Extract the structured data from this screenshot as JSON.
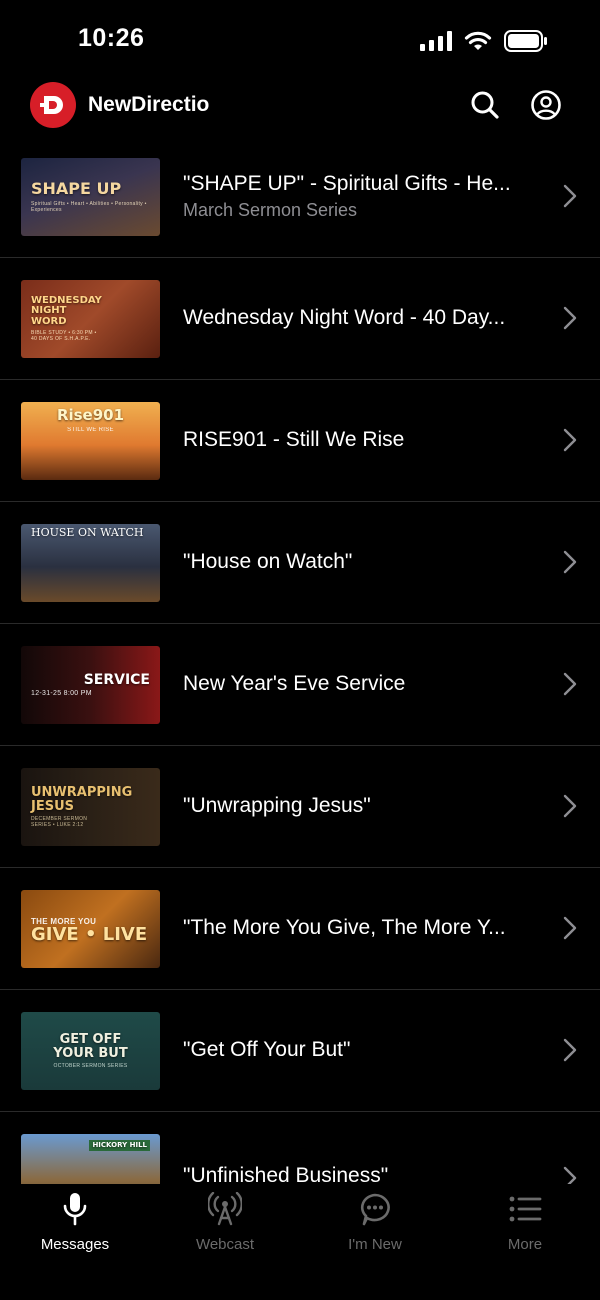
{
  "status": {
    "time": "10:26"
  },
  "header": {
    "title": "NewDirectio"
  },
  "items": [
    {
      "title": "\"SHAPE UP\" - Spiritual Gifts - He...",
      "subtitle": "March Sermon Series",
      "thumb": {
        "title": "SHAPE UP",
        "sub": "Spiritual Gifts • Heart • Abilities • Personality • Experiences"
      }
    },
    {
      "title": "Wednesday Night Word - 40 Day...",
      "subtitle": "",
      "thumb": {
        "title": "WEDNESDAY NIGHT WORD",
        "sub": "BIBLE STUDY • 6:30 PM  •  40 DAYS OF S.H.A.P.E."
      }
    },
    {
      "title": "RISE901 - Still We Rise",
      "subtitle": "",
      "thumb": {
        "title": "Rise901",
        "sub": "STILL WE RISE"
      }
    },
    {
      "title": "\"House on Watch\"",
      "subtitle": "",
      "thumb": {
        "title": "HOUSE ON WATCH",
        "sub": ""
      }
    },
    {
      "title": "New Year's Eve Service",
      "subtitle": "",
      "thumb": {
        "title": "SERVICE",
        "sub": "12-31-25  8:00 PM"
      }
    },
    {
      "title": "\"Unwrapping Jesus\"",
      "subtitle": "",
      "thumb": {
        "title": "UNWRAPPING JESUS",
        "sub": "DECEMBER SERMON SERIES • LUKE 2:12"
      }
    },
    {
      "title": "\"The More You Give, The More Y...",
      "subtitle": "",
      "thumb": {
        "title": "GIVE • LIVE",
        "sub": "THE MORE YOU"
      }
    },
    {
      "title": "\"Get Off Your But\"",
      "subtitle": "",
      "thumb": {
        "title": "GET OFF YOUR BUT",
        "sub": "OCTOBER SERMON SERIES"
      }
    },
    {
      "title": "\"Unfinished Business\"",
      "subtitle": "",
      "thumb": {
        "title": "HICKORY HILL",
        "sub": ""
      }
    }
  ],
  "tabs": [
    {
      "label": "Messages",
      "icon": "microphone-icon",
      "active": true
    },
    {
      "label": "Webcast",
      "icon": "broadcast-icon",
      "active": false
    },
    {
      "label": "I'm New",
      "icon": "chat-bubble-icon",
      "active": false
    },
    {
      "label": "More",
      "icon": "list-icon",
      "active": false
    }
  ],
  "colors": {
    "accent": "#d71e28",
    "inactive": "#6b6b6b",
    "divider": "#2a2a2a"
  }
}
